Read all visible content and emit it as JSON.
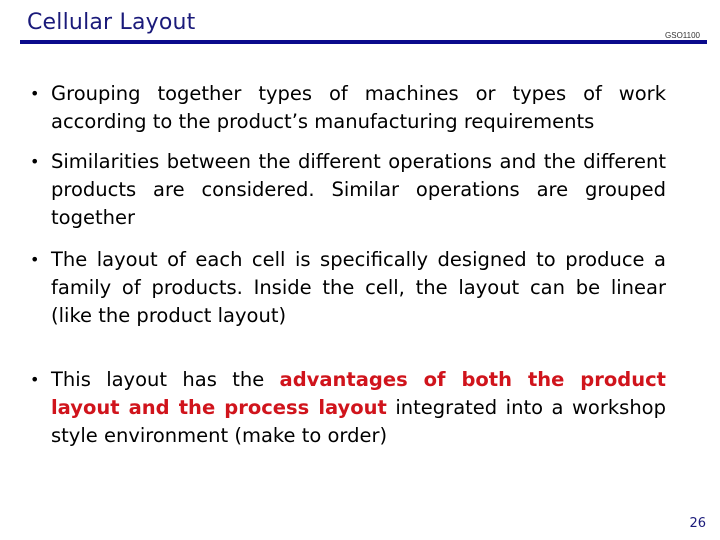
{
  "header": {
    "title": "Cellular Layout",
    "course_code": "GSO1100"
  },
  "bullets": [
    {
      "text": "Grouping together types of machines or types of work according to the product’s manufacturing requirements"
    },
    {
      "text": "Similarities between the different operations and the different products are considered. Similar operations are grouped together"
    },
    {
      "text": "The layout of each cell is specifically designed to produce a family of products. Inside the cell, the layout can be linear (like the product layout)"
    },
    {
      "pre": "This layout has the ",
      "highlight": "advantages of both the product layout and the process layout",
      "post": " integrated into a workshop style environment (make to order)",
      "highlight_color": "#d0141c"
    }
  ],
  "footer": {
    "page_number": "26"
  }
}
